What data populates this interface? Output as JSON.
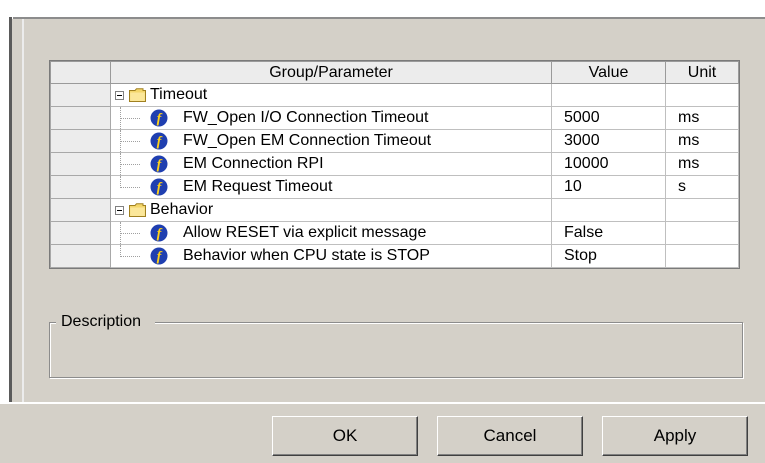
{
  "table": {
    "headers": {
      "group": "Group/Parameter",
      "value": "Value",
      "unit": "Unit"
    },
    "groups": [
      {
        "label": "Timeout",
        "params": [
          {
            "label": "FW_Open I/O Connection Timeout",
            "value": "5000",
            "unit": "ms"
          },
          {
            "label": "FW_Open EM Connection Timeout",
            "value": "3000",
            "unit": "ms"
          },
          {
            "label": "EM Connection RPI",
            "value": "10000",
            "unit": "ms"
          },
          {
            "label": "EM Request Timeout",
            "value": "10",
            "unit": "s"
          }
        ]
      },
      {
        "label": "Behavior",
        "params": [
          {
            "label": "Allow RESET via explicit message",
            "value": "False",
            "unit": ""
          },
          {
            "label": "Behavior when CPU state is STOP",
            "value": "Stop",
            "unit": ""
          }
        ]
      }
    ]
  },
  "description": {
    "title": "Description",
    "text": ""
  },
  "buttons": {
    "ok": "OK",
    "cancel": "Cancel",
    "apply": "Apply"
  },
  "colors": {
    "panel": "#d4d0c8",
    "icon_blue": "#1f3fb0",
    "icon_yellow": "#ffd21a",
    "folder": "#f3d66a"
  }
}
